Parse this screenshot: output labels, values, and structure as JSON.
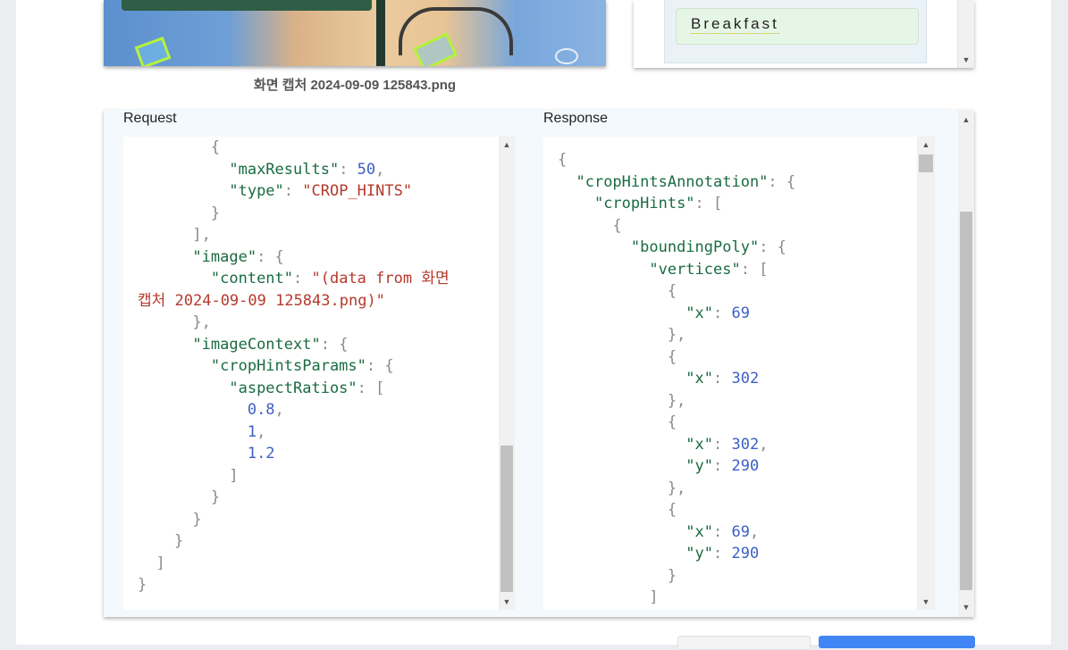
{
  "image_caption": "화면 캡처 2024-09-09 125843.png",
  "label_chip": "Breakfast",
  "request": {
    "title": "Request"
  },
  "response": {
    "title": "Response"
  },
  "colors": {
    "json_key": "#1a6b43",
    "json_string": "#b53a2c",
    "json_number": "#3d5fc4",
    "punctuation": "#8a8a8a",
    "primary_button": "#4285f4"
  },
  "icons": {
    "scroll_up": "triangle-up",
    "scroll_down": "triangle-down"
  }
}
